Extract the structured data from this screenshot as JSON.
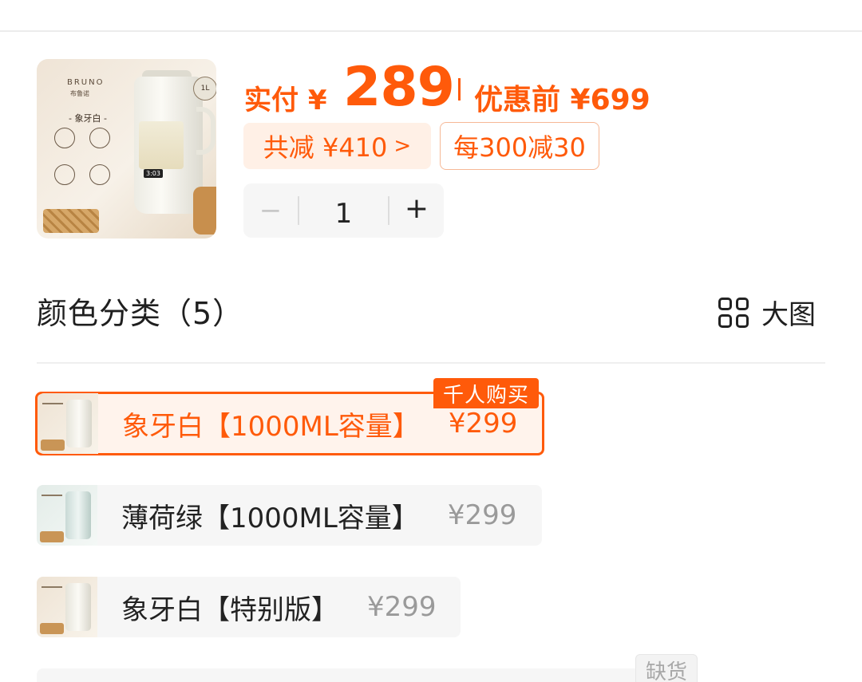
{
  "product": {
    "thumb_brand": "BRUNO",
    "thumb_brand_sub": "布鲁诺",
    "thumb_name": "- 象牙白 -",
    "thumb_badge": "1L",
    "thumb_display": "3:03"
  },
  "price": {
    "pay_label": "实付 ¥",
    "pay_amount": "289",
    "pre_price": "优惠前 ¥699",
    "discount_total": "共减 ¥410",
    "promo": "每300减30"
  },
  "quantity": {
    "minus": "−",
    "value": "1",
    "plus": "+"
  },
  "section": {
    "title": "颜色分类（5）",
    "big_view_label": "大图"
  },
  "options": [
    {
      "name": "象牙白【1000ML容量】",
      "price": "¥299",
      "badge": "千人购买",
      "selected": true
    },
    {
      "name": "薄荷绿【1000ML容量】",
      "price": "¥299",
      "selected": false
    },
    {
      "name": "象牙白【特别版】",
      "price": "¥299",
      "selected": false
    }
  ],
  "out_of_stock_label": "缺货",
  "colors": {
    "accent": "#ff5a0a",
    "accent_bg": "#fff0e6",
    "option_bg": "#f6f6f6",
    "muted_text": "#9a9a9a"
  }
}
